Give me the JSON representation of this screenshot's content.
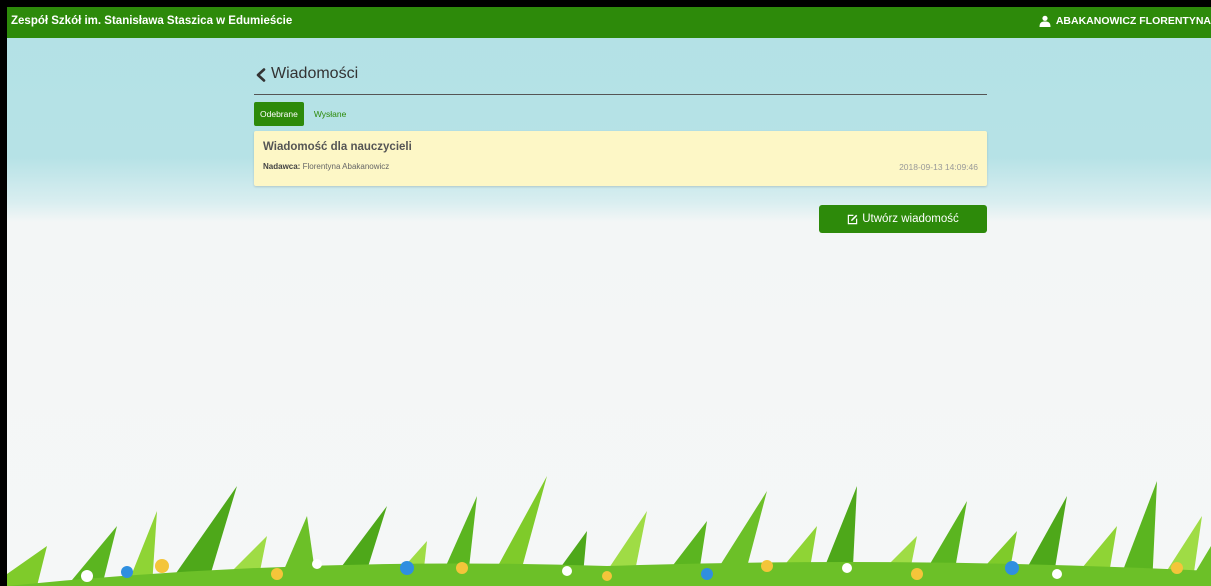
{
  "header": {
    "school_name": "Zespół Szkół im. Stanisława Staszica w Edumieście",
    "user_name": "ABAKANOWICZ FLORENTYNA"
  },
  "page": {
    "title": "Wiadomości"
  },
  "tabs": [
    {
      "label": "Odebrane",
      "active": true
    },
    {
      "label": "Wysłane",
      "active": false
    }
  ],
  "messages": [
    {
      "subject": "Wiadomość dla nauczycieli",
      "sender_label": "Nadawca:",
      "sender": "Florentyna Abakanowicz",
      "date": "2018-09-13 14:09:46"
    }
  ],
  "compose_label": "Utwórz wiadomość",
  "colors": {
    "primary": "#2d8a0a",
    "message_bg": "#fdf7c6",
    "sky": "#b3e1e6"
  },
  "icons": {
    "user": "user-icon",
    "back": "chevron-left-icon",
    "compose": "edit-icon"
  }
}
